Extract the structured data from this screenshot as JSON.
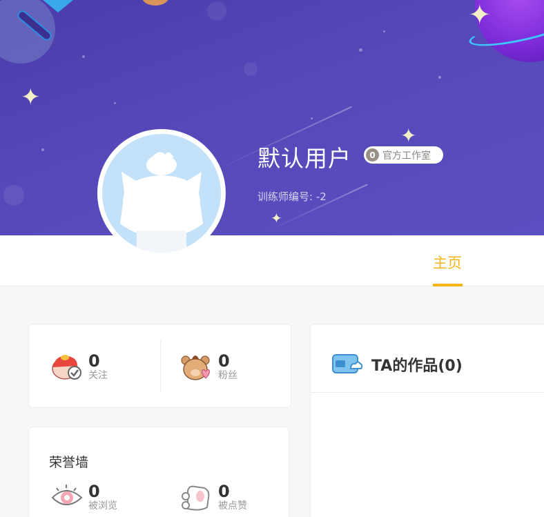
{
  "profile": {
    "username": "默认用户",
    "badge_count": "0",
    "badge_label": "官方工作室",
    "trainer_id": "训练师编号: -2"
  },
  "nav": {
    "tabs": [
      {
        "label": "主页",
        "active": true
      }
    ]
  },
  "stats": {
    "following": {
      "count": "0",
      "label": "关注",
      "icon": "following-icon"
    },
    "fans": {
      "count": "0",
      "label": "粉丝",
      "icon": "fans-icon"
    }
  },
  "honor": {
    "title": "荣誉墙",
    "views": {
      "count": "0",
      "label": "被浏览",
      "icon": "eye-icon"
    },
    "likes": {
      "count": "0",
      "label": "被点赞",
      "icon": "paw-icon"
    }
  },
  "works": {
    "title": "TA的作品(0)",
    "icon": "works-icon"
  },
  "colors": {
    "banner": "#5648b8",
    "accent": "#f5b41a",
    "avatar_bg": "#c3e1f8"
  }
}
